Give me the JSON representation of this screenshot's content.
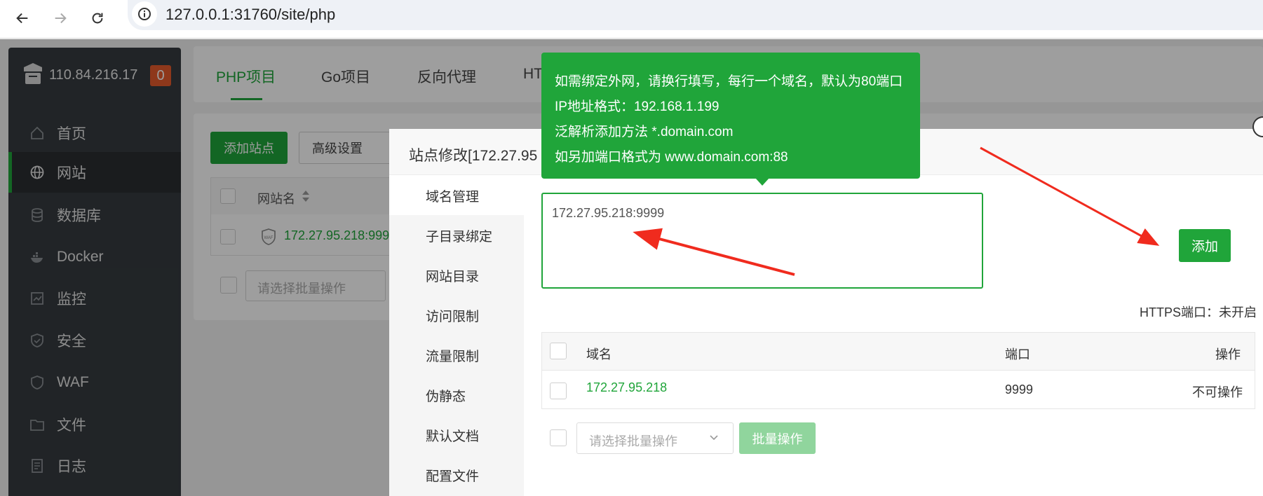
{
  "browser": {
    "url": "127.0.0.1:31760/site/php"
  },
  "sidebar": {
    "server_ip": "110.84.216.17",
    "badge_count": "0",
    "items": [
      {
        "label": "首页",
        "icon": "home-icon"
      },
      {
        "label": "网站",
        "icon": "globe-icon",
        "active": true
      },
      {
        "label": "数据库",
        "icon": "database-icon"
      },
      {
        "label": "Docker",
        "icon": "docker-icon"
      },
      {
        "label": "监控",
        "icon": "monitor-icon"
      },
      {
        "label": "安全",
        "icon": "shield-icon"
      },
      {
        "label": "WAF",
        "icon": "waf-icon"
      },
      {
        "label": "文件",
        "icon": "folder-icon"
      },
      {
        "label": "日志",
        "icon": "log-icon"
      }
    ]
  },
  "project_tabs": [
    "PHP项目",
    "Go项目",
    "反向代理",
    "HT"
  ],
  "toolbar": {
    "add_site": "添加站点",
    "advanced": "高级设置"
  },
  "site_table": {
    "header": "网站名",
    "rows": [
      "172.27.95.218:999"
    ],
    "batch_placeholder": "请选择批量操作"
  },
  "modal": {
    "title": "站点修改[172.27.95",
    "menu": [
      "域名管理",
      "子目录绑定",
      "网站目录",
      "访问限制",
      "流量限制",
      "伪静态",
      "默认文档",
      "配置文件"
    ],
    "domain_input_value": "172.27.95.218:9999",
    "add_button": "添加",
    "https_status": "HTTPS端口：未开启",
    "table": {
      "headers": {
        "domain": "域名",
        "port": "端口",
        "action": "操作"
      },
      "rows": [
        {
          "domain": "172.27.95.218",
          "port": "9999",
          "action": "不可操作"
        }
      ]
    },
    "batch_placeholder": "请选择批量操作",
    "batch_button": "批量操作"
  },
  "tooltip": {
    "lines": [
      "如需绑定外网，请换行填写，每行一个域名，默认为80端口",
      "IP地址格式：192.168.1.199",
      "泛解析添加方法 *.domain.com",
      "如另加端口格式为 www.domain.com:88"
    ]
  },
  "colors": {
    "brand_green": "#20a53a",
    "sidebar_bg": "#363b3f",
    "annotation_red": "#f02b1e"
  }
}
